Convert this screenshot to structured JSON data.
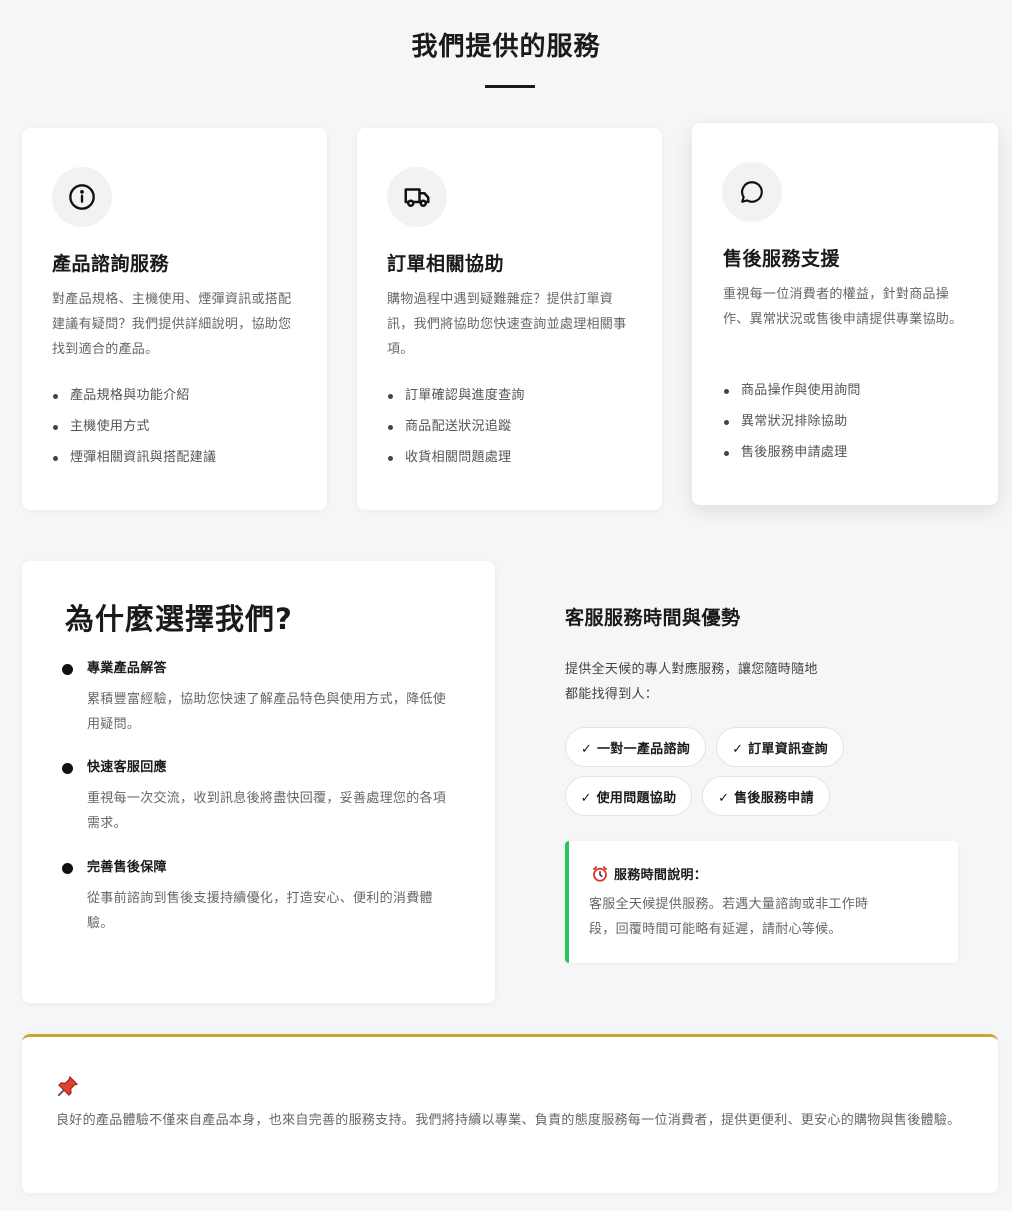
{
  "header": {
    "title": "我們提供的服務"
  },
  "services": [
    {
      "icon": "info-icon",
      "title": "產品諮詢服務",
      "description": "對產品規格、主機使用、煙彈資訊或搭配建議有疑問？我們提供詳細說明，協助您找到適合的產品。",
      "items": [
        "產品規格與功能介紹",
        "主機使用方式",
        "煙彈相關資訊與搭配建議"
      ]
    },
    {
      "icon": "truck-icon",
      "title": "訂單相關協助",
      "description": "購物過程中遇到疑難雜症？提供訂單資訊，我們將協助您快速查詢並處理相關事項。",
      "items": [
        "訂單確認與進度查詢",
        "商品配送狀況追蹤",
        "收貨相關問題處理"
      ]
    },
    {
      "icon": "chat-bubble-icon",
      "title": "售後服務支援",
      "description": "重視每一位消費者的權益，針對商品操作、異常狀況或售後申請提供專業協助。",
      "items": [
        "商品操作與使用詢問",
        "異常狀況排除協助",
        "售後服務申請處理"
      ]
    }
  ],
  "why": {
    "title": "為什麼選擇我們?",
    "items": [
      {
        "heading": "專業產品解答",
        "body": "累積豐富經驗，協助您快速了解產品特色與使用方式，降低使用疑問。"
      },
      {
        "heading": "快速客服回應",
        "body": "重視每一次交流，收到訊息後將盡快回覆，妥善處理您的各項需求。"
      },
      {
        "heading": "完善售後保障",
        "body": "從事前諮詢到售後支援持續優化，打造安心、便利的消費體驗。"
      }
    ]
  },
  "support": {
    "title": "客服服務時間與優勢",
    "description_line1": "提供全天候的專人對應服務，讓您隨時隨地",
    "description_line2": "都能找得到人：",
    "tags": [
      "✓ 一對一產品諮詢",
      "✓ 訂單資訊查詢",
      "✓ 使用問題協助",
      "✓ 售後服務申請"
    ],
    "hours": {
      "icon": "alarm-clock-icon",
      "heading": "服務時間說明：",
      "body": "客服全天候提供服務。若遇大量諮詢或非工作時段，回覆時間可能略有延遲，請耐心等候。"
    }
  },
  "note": {
    "icon": "pushpin-icon",
    "text": "良好的產品體驗不僅來自產品本身，也來自完善的服務支持。我們將持續以專業、負責的態度服務每一位消費者，提供更便利、更安心的購物與售後體驗。"
  },
  "colors": {
    "accent_green": "#22c55e",
    "accent_gold": "#c9a83a",
    "background": "#f5f6f8"
  }
}
